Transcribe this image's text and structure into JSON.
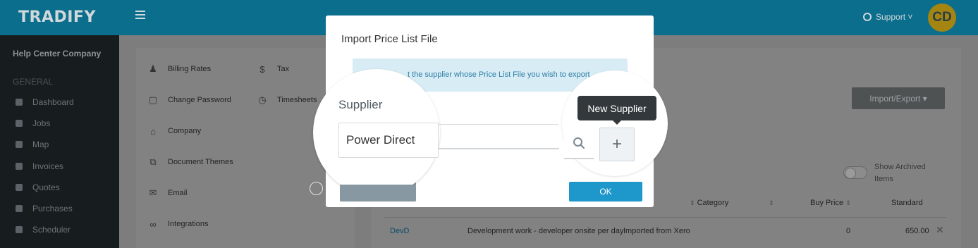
{
  "app": {
    "logo": "TRADIFY"
  },
  "header": {
    "support_label": "Support ˅",
    "avatar_initials": "CD"
  },
  "sidebar": {
    "company": "Help Center Company",
    "section": "GENERAL",
    "items": [
      {
        "label": "Dashboard",
        "icon": "dashboard-icon"
      },
      {
        "label": "Jobs",
        "icon": "hammer-icon"
      },
      {
        "label": "Map",
        "icon": "map-pin-icon"
      },
      {
        "label": "Invoices",
        "icon": "invoice-icon"
      },
      {
        "label": "Quotes",
        "icon": "calculator-icon"
      },
      {
        "label": "Purchases",
        "icon": "cart-icon"
      },
      {
        "label": "Scheduler",
        "icon": "calendar-icon"
      }
    ]
  },
  "settings": {
    "items": [
      {
        "label": "Billing Rates",
        "icon": "person-icon"
      },
      {
        "label": "Tax",
        "icon": "dollar-icon"
      },
      {
        "label": "Change Password",
        "icon": "lock-icon"
      },
      {
        "label": "Timesheets",
        "icon": "clock-icon"
      },
      {
        "label": "Company",
        "icon": "home-icon"
      },
      {
        "label": "Document Themes",
        "icon": "copy-icon"
      },
      {
        "label": "Email",
        "icon": "envelope-icon"
      },
      {
        "label": "Integrations",
        "icon": "link-icon"
      }
    ]
  },
  "toolbar": {
    "import_export_label": "Import/Export ▾"
  },
  "table": {
    "show_archived_label": "Show Archived Items",
    "headers": {
      "category": "Category",
      "buy_price": "Buy Price",
      "standard": "Standard"
    },
    "rows": [
      {
        "code": "DevD",
        "description": "Development work - developer onsite per day",
        "category": "Imported from Xero",
        "buy_price": "0",
        "standard": "650.00"
      }
    ]
  },
  "modal": {
    "title": "Import Price List File",
    "info": "t the supplier whose Price List File you wish to export",
    "supplier_label": "Supplier",
    "supplier_value": "Power Direct",
    "tooltip": "New Supplier",
    "add_symbol": "+",
    "ok_label": "OK"
  },
  "colors": {
    "header": "#0b6e8c",
    "ok_button": "#1e97ca",
    "tooltip": "#32383b"
  }
}
